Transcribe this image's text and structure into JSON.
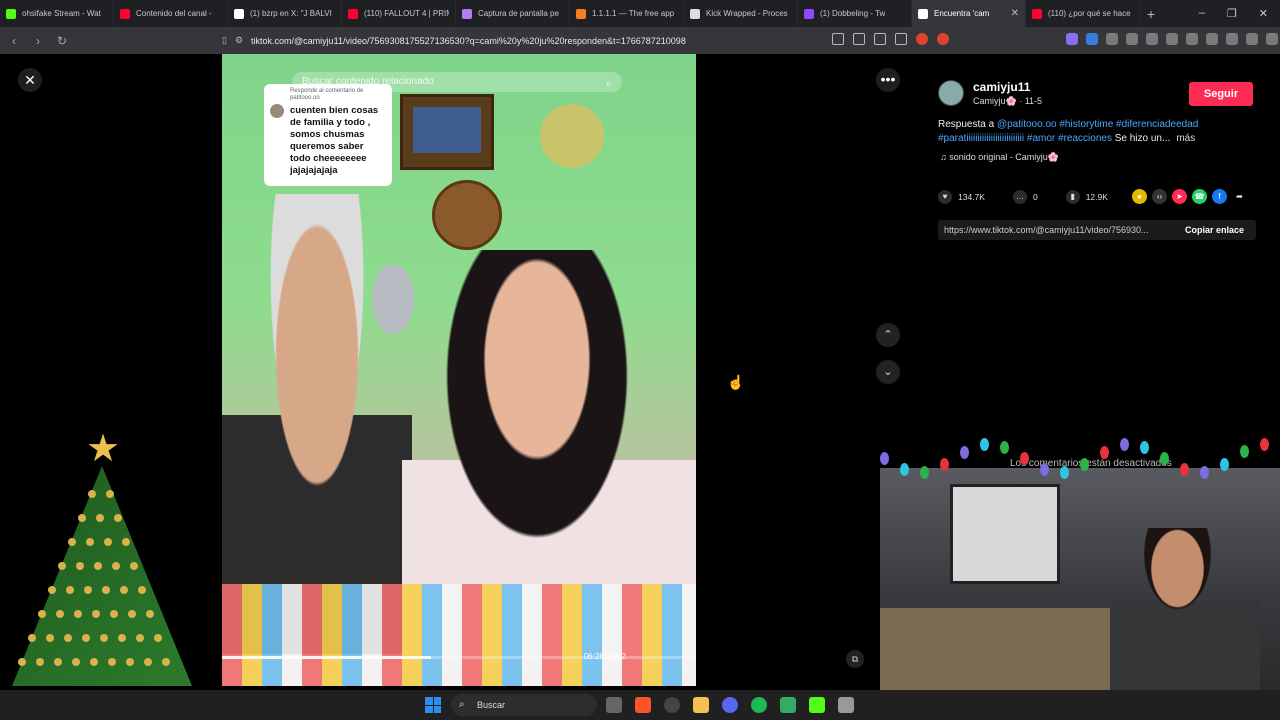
{
  "browser": {
    "tabs": [
      {
        "title": "ohsifake Stream - Wat",
        "color": "#53fc18"
      },
      {
        "title": "Contenido del canal -",
        "color": "#ff0033"
      },
      {
        "title": "(1) bzrp en X: \"J BALVI",
        "color": "#ffffff"
      },
      {
        "title": "(110) FALLOUT 4 | PRIM",
        "color": "#ff0033"
      },
      {
        "title": "Captura de pantalla pe",
        "color": "#b37cf0"
      },
      {
        "title": "1.1.1.1 — The free app",
        "color": "#f38020"
      },
      {
        "title": "Kick Wrapped - Proces",
        "color": "#dddddd"
      },
      {
        "title": "(1) Dobbeling - Tw",
        "color": "#9146ff"
      },
      {
        "title": "Encuentra 'cam",
        "color": "#ffffff",
        "active": true
      },
      {
        "title": "(110) ¿por qué se hace",
        "color": "#ff0033"
      }
    ],
    "new_tab": "+",
    "window_controls": [
      "–",
      "❐",
      "✕"
    ],
    "url": "tiktok.com/@camiyju11/video/7569308175527136530?q=cami%20y%20ju%20responden&t=1766787210098"
  },
  "viewer": {
    "close": "✕",
    "more": "•••",
    "nav_up": "⌃",
    "nav_down": "⌄",
    "search_placeholder": "Buscar contenido relacionado",
    "reply_card": {
      "header": "Responde al comentario de patitooo.oo",
      "text": "cuenten bien cosas de familia y todo , somos chusmas queremos saber todo cheeeeeeee jajajajajaja"
    },
    "timecode": "06:28/14:12",
    "progress": 0.44
  },
  "panel": {
    "username": "camiyju11",
    "nickname": "Camiyju🌸 · 11-5",
    "follow": "Seguir",
    "desc_prefix": "Respuesta a ",
    "desc_mention": "@patitooo.oo",
    "desc_tags": "#historytime #diferenciadeedad #paratiiiiiiiiiiiiiiiiiiiiiiiiii #amor #reacciones",
    "desc_tail": " Se hizo un...",
    "more": "más",
    "sound": "♫  sonido original - Camiyju🌸",
    "likes": "134.7K",
    "comments": "0",
    "saves": "12.9K",
    "link": "https://www.tiktok.com/@camiyju11/video/756930...",
    "copy": "Copiar enlace"
  },
  "overlay": {
    "comments_disabled": "Los comentarios están desactivados"
  },
  "taskbar": {
    "search": "Buscar"
  }
}
